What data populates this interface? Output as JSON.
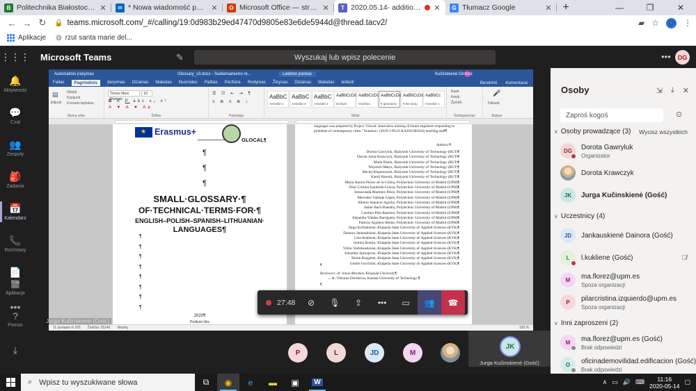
{
  "browser": {
    "tabs": [
      {
        "title": "Politechnika Białostocka - Serwer",
        "favicon": "B",
        "color": "#1e7d32",
        "active": false
      },
      {
        "title": "* Nowa wiadomość pocztowa",
        "favicon": "✉",
        "color": "#0a66c2",
        "active": false
      },
      {
        "title": "Microsoft Office — strona główna",
        "favicon": "O",
        "color": "#d83b01",
        "active": false
      },
      {
        "title": "2020.05.14- additional meeting",
        "favicon": "T",
        "color": "#5b5fc7",
        "active": true
      },
      {
        "title": "Tłumacz Google",
        "favicon": "G",
        "color": "#4285f4",
        "active": false
      }
    ],
    "url": "teams.microsoft.com/_#/calling/19:0d983b29ed47470d9805e83e6de5944d@thread.tacv2/",
    "profile_initial": "D",
    "bookmarks": [
      {
        "label": "Aplikacje",
        "icon": "apps-grid-icon"
      },
      {
        "label": "rzut santa marie del...",
        "icon": "globe-icon"
      }
    ]
  },
  "teams": {
    "app_title": "Microsoft Teams",
    "search_placeholder": "Wyszukaj lub wpisz polecenie",
    "user_initials": "DG",
    "rail": [
      {
        "label": "Aktywność",
        "icon": "bell-icon",
        "glyph": "🔔"
      },
      {
        "label": "Czat",
        "icon": "chat-icon",
        "glyph": "💬"
      },
      {
        "label": "Zespoły",
        "icon": "teams-icon",
        "glyph": "👥"
      },
      {
        "label": "Zadania",
        "icon": "assignments-icon",
        "glyph": "🎒"
      },
      {
        "label": "Kalendarz",
        "icon": "calendar-icon",
        "glyph": "📅"
      },
      {
        "label": "Rozmowy",
        "icon": "phone-icon",
        "glyph": "📞"
      },
      {
        "label": "Pliki",
        "icon": "files-icon",
        "glyph": "📄"
      },
      {
        "label": "",
        "icon": "more-icon",
        "glyph": "•••"
      }
    ],
    "rail_bottom": [
      {
        "label": "Aplikacje",
        "icon": "apps-icon",
        "glyph": "▦"
      },
      {
        "label": "Pomoc",
        "icon": "help-icon",
        "glyph": "?"
      }
    ]
  },
  "word": {
    "title_left": "Automatinis įrašymas",
    "filename": "Glossary_v3.docx - Suderinamumo re...",
    "mode": "Leidimo įrankiai",
    "user": "Kučinskienė Gintarė",
    "user_initials": "KG",
    "tabs": [
      "Failas",
      "Pagrindinis",
      "Įterpimas",
      "Dizainas",
      "Maketas",
      "Nuorodos",
      "Paštas",
      "Peržiūra",
      "Rodymas",
      "Žinynas",
      "Dizainas",
      "Maketas",
      "Ieškoti"
    ],
    "tabs_right": [
      "Bendrinti",
      "Komentarai"
    ],
    "clipboard": [
      "Iškirpti",
      "Kopijuoti",
      "Formato teptukas"
    ],
    "paste_label": "Įklijuoti",
    "group_labels": [
      "Mainų sritis",
      "Šriftas",
      "Pastraipa",
      "Stiliai",
      "Redagavimas",
      "Balsas"
    ],
    "font_name": "Times New Roman",
    "font_size": "10",
    "styles": [
      {
        "big": "AaBbC",
        "small": "Antraštė 2"
      },
      {
        "big": "AaBbC",
        "small": "Antraštė 3"
      },
      {
        "big": "AaBbC",
        "small": "Antraštė 4"
      },
      {
        "big": "AaBbCcDd",
        "small": "Emfazė"
      },
      {
        "big": "AaBbCcDc",
        "small": "Griežtas"
      },
      {
        "big": "AaBbCcDd",
        "small": "¶ Įprastasis"
      },
      {
        "big": "AaBbCcDd",
        "small": "¶ Be tarpų"
      },
      {
        "big": "AaBbCc",
        "small": "Antraštė 1"
      }
    ],
    "editing": [
      "Rasti",
      "Keisti",
      "Žymėti"
    ],
    "dictate": "Diktuoti",
    "status_left": "11 puslapis iš 165",
    "status_words": "Žodžiai: 25140",
    "status_lang": "lietuvių",
    "status_zoom": "100 %",
    "page1": {
      "erasmus": "Erasmus+",
      "glocal": "GLOCAL¶",
      "title1": "SMALL·GLOSSARY·¶",
      "title2": "OF·TECHNICAL·TERMS·FOR·¶",
      "title3": "ENGLISH–POLISH–SPANISH–LITHUANIAN·",
      "title4": "LANGUAGES¶",
      "pilcrow": "¶",
      "year": "2020¶",
      "footer": "Podłoże lūlis"
    },
    "page2": {
      "intro": "languages was prepared by Project \"Glocal- Innovative training of future engineers responding to problems of contemporary cities.\" Erasmus+ (2019-1-PL01-KA203-065654) teaching staff¶",
      "authors_label": "Authors:¶",
      "authors": [
        "Dorota·Gawryluk,·Bialystok·University·of·Technology·(BUT)¶",
        "Dorota·Anna·Krawczyk,·Bialystok·University·of·Technology·(BUT)¶",
        "Marta·Baum,·Bialystok·University·of·Technology·(BUT)¶",
        "Wojciech·Matys,·Bialystok·University·of·Technology·(BUT)¶",
        "Maciej·Kłopotowski,·Bialystok·University·of·Technology·(BUT)¶",
        "Kamil·Rawski,·Bialystok·University·of·Technology·(BUT)¶",
        "María·Aurora·Flórez·de·la·Colina,·Polytechnic·University·of·Madrid·(UPM)¶",
        "Pilar·Cristina·Izquierdo-Gracia,·Polytechnic·University·of·Madrid·(UPM)¶",
        "Inmaculada·Martínez·Pérez,·Polytechnic·University·of·Madrid·(UPM)¶",
        "Mercedes·Valiente·López,·Polytechnic·University·of·Madrid·(UPM)¶",
        "Alberto·Sepulcre·Aguilar,·Polytechnic·University·of·Madrid·(UPM)¶",
        "Isabel·Bach·Buendía,·Polytechnic·University·of·Madrid·(UPM)¶",
        "Carolina·Piña·Ramírez,·Polytechnic·University·of·Madrid·(UPM)¶",
        "Alejandra·Vidales·Barriguete,·Polytechnic·University·of·Madrid·(UPM)¶",
        "Patricia·Aguilera·Benito,·Polytechnic·University·of·Madrid·(UPM)¶",
        "Jurga·Kučinskienė,·Klaipeda·State·University·of·Applied·Sciences·(KVK)¶",
        "Dainora·Jankauskienė,·Klaipeda·State·University·of·Applied·Sciences·(KVK)¶",
        "Lina·Kuklienė,·Klaipeda·State·University·of·Applied·Sciences·(KVK)¶",
        "Indrius·Kuklys,·Klaipeda·State·University·of·Applied·Sciences·(KVK)¶",
        "Vilma·Vaičekauskienė,·Klaipeda·State·University·of·Applied·Sciences·(KVK)¶",
        "Eduardas·Spiriajevas,·Klaipeda·State·University·of·Applied·Sciences·(KVK)¶",
        "Birutė·Ruzgienė,·Klaipeda·State·University·of·Applied·Sciences·(KVK)¶",
        "Giedrė·Ivavičiūtė,·Klaipeda·State·University·of·Applied·Sciences·(KVK)¶"
      ],
      "reviewers": "Reviewers:·dr.·Jonas·Abromas,·Klaipeda·University¶",
      "reviewer2": "→ dr.·Viktoras·Doroševas,·Kaunas·University·of·Technology·¶"
    }
  },
  "meeting": {
    "presenter_label": "Jurga Kučinskienė (Gość)",
    "timer": "27:48",
    "gallery": [
      {
        "initials": "P",
        "bg": "#f6d7dc",
        "fg": "#8e192e"
      },
      {
        "initials": "L",
        "bg": "#f0d9d9",
        "fg": "#8e192e"
      },
      {
        "initials": "JD",
        "bg": "#dbe9f7",
        "fg": "#1b5a9c"
      },
      {
        "initials": "M",
        "bg": "#f3d6ef",
        "fg": "#8a1a7d"
      }
    ],
    "speaker": {
      "initials": "JK",
      "name": "Jurga Kučinskienė (Gość)"
    }
  },
  "people": {
    "title": "Osoby",
    "invite_placeholder": "Zaproś kogoś",
    "mute_all": "Wycisz wszystkich",
    "sections": [
      {
        "header": "Osoby prowadzące (3)",
        "people": [
          {
            "name": "Dorota Gawryluk",
            "sub": "Organizator",
            "initials": "DG",
            "bg": "#f3d6d8",
            "fg": "#a4262c",
            "status": "#c4314b",
            "bold": false,
            "photo": false
          },
          {
            "name": "Dorota Krawczyk",
            "sub": "",
            "initials": "",
            "bg": "",
            "fg": "",
            "status": "",
            "bold": false,
            "photo": true
          },
          {
            "name": "Jurga Kučinskienė (Gość)",
            "sub": "",
            "initials": "JK",
            "bg": "#cbe7e3",
            "fg": "#1a6e67",
            "status": "",
            "bold": true,
            "photo": false
          }
        ]
      },
      {
        "header": "Uczestnicy (4)",
        "people": [
          {
            "name": "Jankauskienė Dainora (Gość)",
            "sub": "",
            "initials": "JD",
            "bg": "#dbe9f7",
            "fg": "#1b5a9c",
            "status": "",
            "bold": false,
            "photo": false
          },
          {
            "name": "l.kukliene (Gość)",
            "sub": "",
            "initials": "L",
            "bg": "#e3f1dc",
            "fg": "#3b7a1f",
            "status": "#c4314b",
            "bold": false,
            "photo": false,
            "mic_off": true
          },
          {
            "name": "ma.florez@upm.es",
            "sub": "Spoza organizacji",
            "initials": "M",
            "bg": "#f3d6ef",
            "fg": "#8a1a7d",
            "status": "",
            "bold": false,
            "photo": false
          },
          {
            "name": "pilarcristina.izquierdo@upm.es",
            "sub": "Spoza organizacji",
            "initials": "P",
            "bg": "#f6d7dc",
            "fg": "#8e192e",
            "status": "",
            "bold": false,
            "photo": false
          }
        ]
      },
      {
        "header": "Inni zaproszeni (2)",
        "people": [
          {
            "name": "ma.florez@upm.es (Gość)",
            "sub": "Brak odpowiedzi",
            "initials": "M",
            "bg": "#f3d6ef",
            "fg": "#8a1a7d",
            "status": "#8a8886",
            "bold": false,
            "photo": false
          },
          {
            "name": "oficinademovilidad.edificacion (Gość)",
            "sub": "Brak odpowiedzi",
            "initials": "O",
            "bg": "#d5ecec",
            "fg": "#1a6e67",
            "status": "#8a8886",
            "bold": false,
            "photo": false
          }
        ]
      }
    ]
  },
  "taskbar": {
    "search_placeholder": "Wpisz tu wyszukiwane słowa",
    "time": "11:16",
    "date": "2020-05-14",
    "apps": [
      {
        "name": "task-view-icon",
        "glyph": "⧉"
      },
      {
        "name": "chrome-icon",
        "glyph": "◉"
      },
      {
        "name": "edge-icon",
        "glyph": "e"
      },
      {
        "name": "file-explorer-icon",
        "glyph": "▬"
      },
      {
        "name": "store-icon",
        "glyph": "▣"
      },
      {
        "name": "word-icon",
        "glyph": "W"
      }
    ]
  }
}
